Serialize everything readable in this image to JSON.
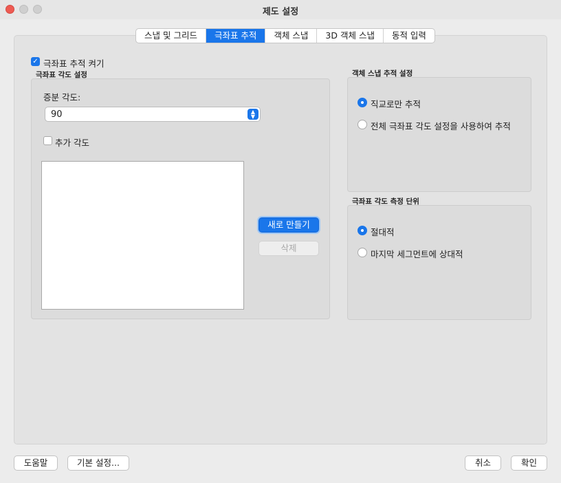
{
  "window": {
    "title": "제도 설정"
  },
  "tabs": [
    {
      "label": "스냅 및 그리드"
    },
    {
      "label": "극좌표 추적"
    },
    {
      "label": "객체 스냅"
    },
    {
      "label": "3D 객체 스냅"
    },
    {
      "label": "동적 입력"
    }
  ],
  "active_tab": "극좌표 추적",
  "polar_on": {
    "label": "극좌표 추적 켜기",
    "checked": true
  },
  "polar_angle_settings": {
    "title": "극좌표 각도 설정",
    "increment_label": "증분 각도:",
    "increment_value": "90",
    "additional_angles": {
      "label": "추가 각도",
      "checked": false
    },
    "new_button": "새로 만들기",
    "delete_button": "삭제"
  },
  "osnap_tracking": {
    "title": "객체 스냅 추적 설정",
    "options": [
      {
        "label": "직교로만 추적",
        "selected": true
      },
      {
        "label": "전체 극좌표 각도 설정을 사용하여 추적",
        "selected": false
      }
    ]
  },
  "polar_measurement": {
    "title": "극좌표 각도 측정 단위",
    "options": [
      {
        "label": "절대적",
        "selected": true
      },
      {
        "label": "마지막 세그먼트에 상대적",
        "selected": false
      }
    ]
  },
  "footer": {
    "help": "도움말",
    "defaults": "기본 설정...",
    "cancel": "취소",
    "ok": "확인"
  },
  "colors": {
    "accent": "#1a76ea",
    "close": "#ee5a52"
  }
}
